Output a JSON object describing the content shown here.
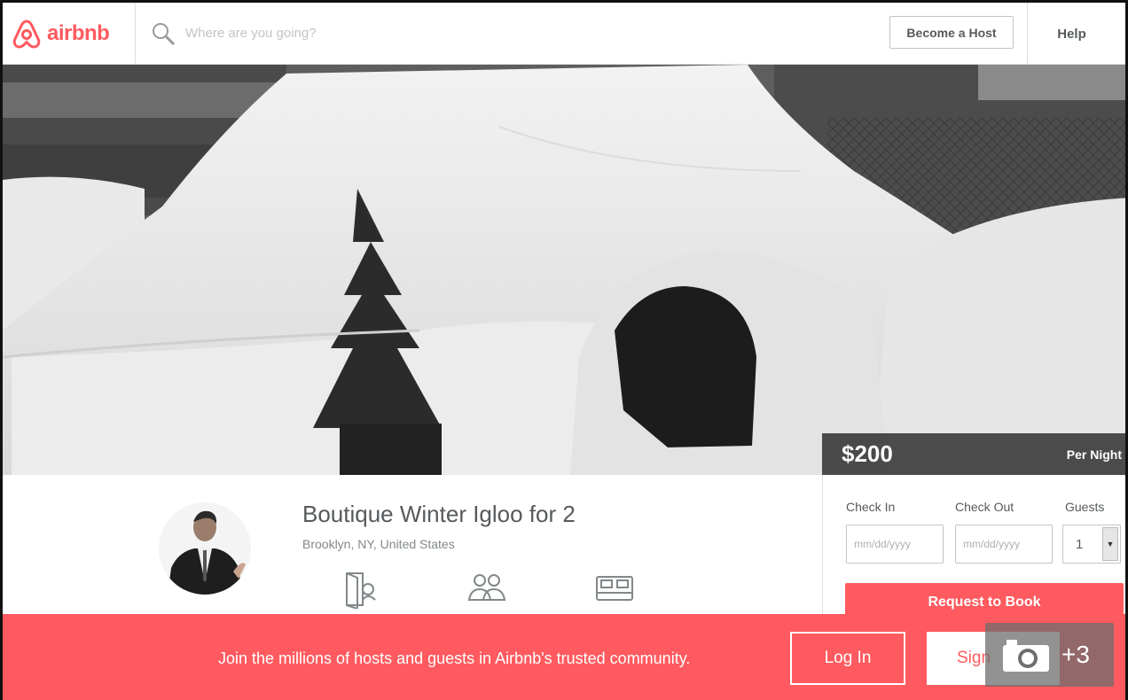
{
  "header": {
    "logo_text": "airbnb",
    "search_placeholder": "Where are you going?",
    "become_host_label": "Become a Host",
    "help_label": "Help"
  },
  "listing": {
    "price": "$200",
    "price_unit": "Per Night",
    "title": "Boutique Winter Igloo for 2",
    "location": "Brooklyn, NY, United States"
  },
  "booking": {
    "check_in_label": "Check In",
    "check_out_label": "Check Out",
    "guests_label": "Guests",
    "check_in_placeholder": "mm/dd/yyyy",
    "check_out_placeholder": "mm/dd/yyyy",
    "guests_value": "1",
    "request_button_label": "Request to Book"
  },
  "footer": {
    "join_text": "Join the millions of hosts and guests in Airbnb's trusted community.",
    "login_label": "Log In",
    "signup_label": "Sign",
    "photo_count": "+3"
  },
  "colors": {
    "brand": "#ff5a5f",
    "price_bar": "#3e3e3e"
  },
  "icons": [
    "airbnb-logo-icon",
    "search-icon",
    "room-type-icon",
    "guests-icon",
    "bed-icon",
    "camera-icon",
    "chevron-down-icon"
  ]
}
